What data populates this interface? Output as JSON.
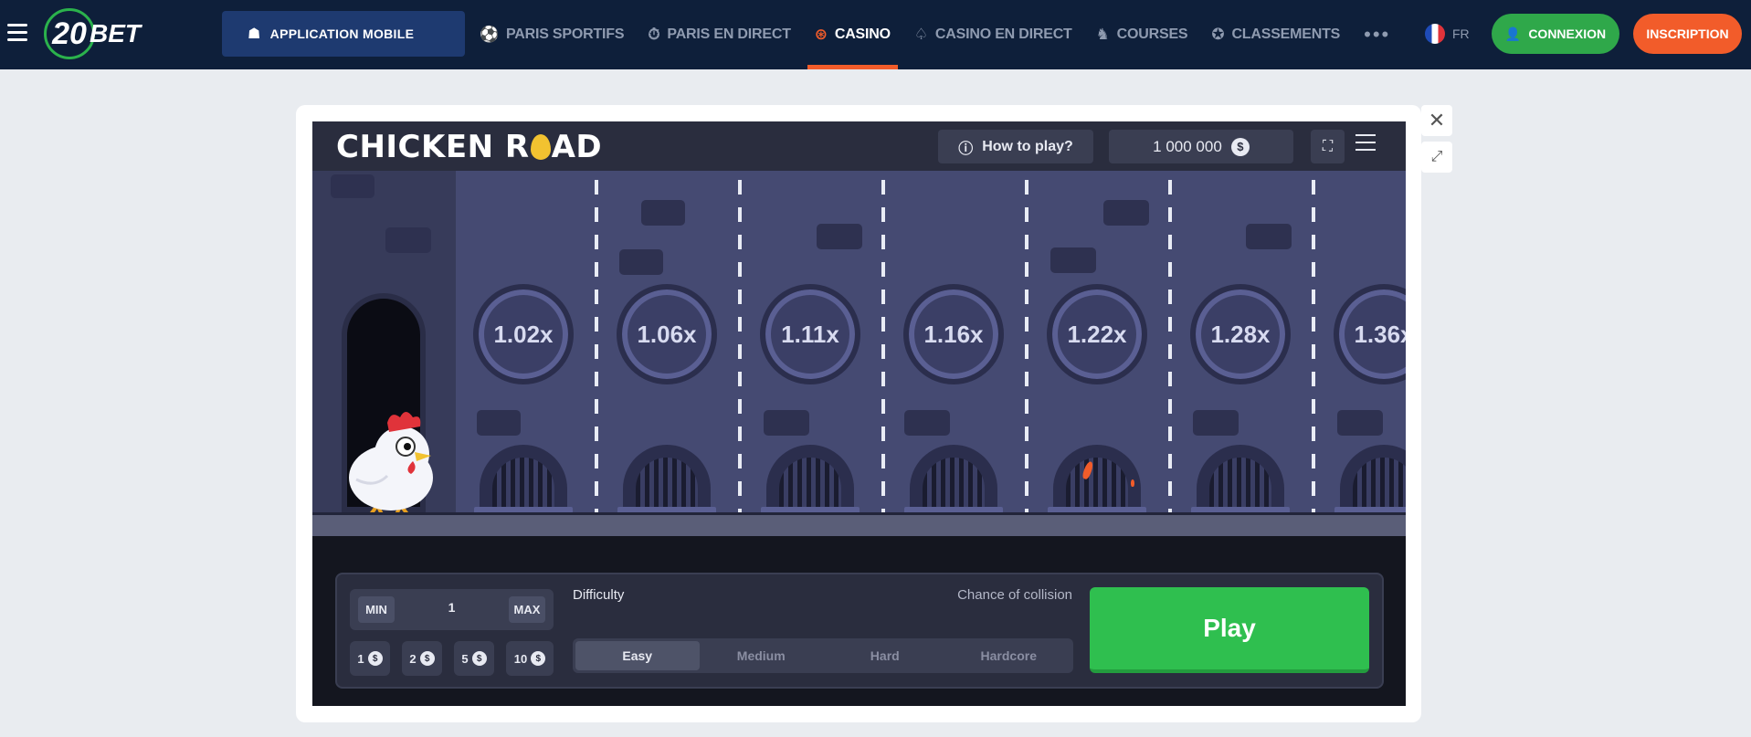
{
  "topbar": {
    "logo_number": "20",
    "logo_text": "BET",
    "app_button": "APPLICATION MOBILE",
    "nav": [
      {
        "label": "PARIS SPORTIFS",
        "icon": "soccer-ball-icon"
      },
      {
        "label": "PARIS EN DIRECT",
        "icon": "stopwatch-icon"
      },
      {
        "label": "CASINO",
        "icon": "roulette-icon",
        "active": true
      },
      {
        "label": "CASINO EN DIRECT",
        "icon": "cards-icon"
      },
      {
        "label": "COURSES",
        "icon": "horse-icon"
      },
      {
        "label": "CLASSEMENTS",
        "icon": "trophy-icon"
      }
    ],
    "more": "•••",
    "lang": "FR",
    "login": "CONNEXION",
    "signup": "INSCRIPTION"
  },
  "game": {
    "title_left": "CHICKEN R",
    "title_right": "AD",
    "how_to_play": "How to play?",
    "balance": "1 000 000",
    "currency_symbol": "$",
    "multipliers": [
      "1.02x",
      "1.06x",
      "1.11x",
      "1.16x",
      "1.22x",
      "1.28x",
      "1.36x"
    ],
    "controls": {
      "min": "MIN",
      "max": "MAX",
      "bet_value": "1",
      "quick_bets": [
        "1",
        "2",
        "5",
        "10"
      ],
      "difficulty_label": "Difficulty",
      "chance_label": "Chance of collision",
      "difficulties": [
        "Easy",
        "Medium",
        "Hard",
        "Hardcore"
      ],
      "selected_difficulty": "Easy",
      "play": "Play"
    }
  },
  "colors": {
    "nav_bg": "#0e1f3a",
    "accent_orange": "#f25c2a",
    "login_green": "#2fa84a",
    "play_green": "#2fbf4f",
    "scene_bg": "#454a72"
  }
}
